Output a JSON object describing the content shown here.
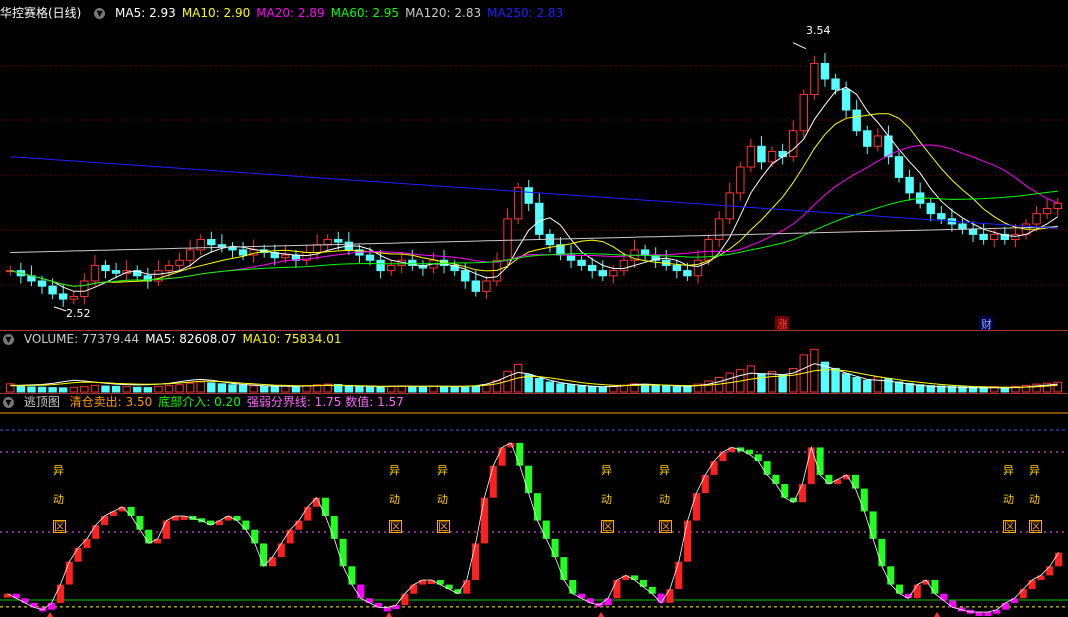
{
  "main": {
    "title": "华控赛格(日线)",
    "ma_labels": [
      {
        "text": "MA5: 2.93",
        "color": "#ffffff"
      },
      {
        "text": "MA10: 2.90",
        "color": "#ffff00"
      },
      {
        "text": "MA20: 2.89",
        "color": "#ff00ff"
      },
      {
        "text": "MA60: 2.95",
        "color": "#00ff00"
      },
      {
        "text": "MA120: 2.83",
        "color": "#cccccc"
      },
      {
        "text": "MA250: 2.83",
        "color": "#2020ff"
      }
    ],
    "high_label": "3.54",
    "low_label": "2.52",
    "tags": [
      "涨",
      "财"
    ]
  },
  "volume": {
    "labels": [
      {
        "text": "VOLUME: 77379.44",
        "color": "#cccccc"
      },
      {
        "text": "MA5: 82608.07",
        "color": "#ffffff"
      },
      {
        "text": "MA10: 75834.01",
        "color": "#ffff00"
      }
    ]
  },
  "indicator": {
    "title": "逃顶图",
    "labels": [
      {
        "text": "清仓卖出: 3.50",
        "color": "#ff9900"
      },
      {
        "text": "底部介入: 0.20",
        "color": "#00ff00"
      },
      {
        "text": "强弱分界线: 1.75 数值: 1.57",
        "color": "#ff66ff"
      }
    ],
    "signal_chars": [
      "异",
      "动",
      "区"
    ]
  },
  "chart_data": {
    "type": "candlestick",
    "price_range": [
      2.45,
      3.62
    ],
    "high": 3.54,
    "low": 2.52,
    "close_series": [
      2.66,
      2.64,
      2.62,
      2.6,
      2.57,
      2.55,
      2.56,
      2.62,
      2.68,
      2.66,
      2.65,
      2.66,
      2.64,
      2.62,
      2.66,
      2.68,
      2.7,
      2.74,
      2.78,
      2.76,
      2.75,
      2.74,
      2.72,
      2.74,
      2.73,
      2.71,
      2.72,
      2.7,
      2.73,
      2.76,
      2.78,
      2.77,
      2.74,
      2.72,
      2.7,
      2.66,
      2.68,
      2.7,
      2.68,
      2.67,
      2.7,
      2.68,
      2.66,
      2.62,
      2.58,
      2.62,
      2.7,
      2.86,
      2.98,
      2.92,
      2.8,
      2.76,
      2.72,
      2.7,
      2.68,
      2.66,
      2.64,
      2.66,
      2.7,
      2.74,
      2.72,
      2.7,
      2.68,
      2.66,
      2.64,
      2.7,
      2.78,
      2.86,
      2.96,
      3.06,
      3.14,
      3.08,
      3.12,
      3.1,
      3.2,
      3.34,
      3.46,
      3.4,
      3.36,
      3.28,
      3.2,
      3.14,
      3.18,
      3.1,
      3.02,
      2.96,
      2.92,
      2.88,
      2.86,
      2.84,
      2.82,
      2.8,
      2.78,
      2.8,
      2.78,
      2.8,
      2.84,
      2.88,
      2.9,
      2.92
    ],
    "volume_series": [
      52,
      38,
      32,
      30,
      28,
      26,
      30,
      34,
      42,
      38,
      36,
      34,
      30,
      28,
      36,
      40,
      46,
      56,
      64,
      58,
      52,
      46,
      42,
      40,
      38,
      36,
      38,
      34,
      40,
      46,
      50,
      48,
      42,
      38,
      34,
      30,
      34,
      36,
      34,
      32,
      36,
      34,
      30,
      30,
      36,
      46,
      72,
      132,
      176,
      110,
      86,
      64,
      52,
      46,
      40,
      36,
      32,
      36,
      44,
      52,
      48,
      42,
      38,
      34,
      34,
      50,
      70,
      92,
      120,
      142,
      166,
      116,
      130,
      110,
      150,
      236,
      272,
      190,
      150,
      116,
      92,
      74,
      96,
      84,
      64,
      54,
      46,
      40,
      38,
      36,
      34,
      32,
      30,
      34,
      30,
      36,
      42,
      50,
      56,
      62
    ],
    "volume_ma5": [
      84,
      86,
      90,
      96,
      110,
      130,
      150,
      140,
      126,
      112,
      100,
      94,
      90,
      92,
      100,
      110,
      130,
      150,
      160,
      150,
      130,
      110,
      96,
      88,
      80,
      76,
      74,
      72,
      76,
      82,
      86,
      84,
      80,
      76,
      72,
      68,
      72,
      76,
      74,
      72,
      74,
      72,
      70,
      72,
      80,
      100,
      140,
      200,
      250,
      230,
      190,
      150,
      120,
      100,
      84,
      74,
      68,
      70,
      80,
      96,
      100,
      94,
      86,
      78,
      74,
      82,
      100,
      130,
      170,
      210,
      240,
      230,
      230,
      220,
      240,
      300,
      360,
      330,
      290,
      240,
      200,
      160,
      150,
      140,
      120,
      100,
      84,
      72,
      66,
      62,
      58,
      54,
      52,
      54,
      52,
      56,
      64,
      76,
      88,
      100
    ],
    "volume_ma10": [
      80,
      82,
      84,
      86,
      94,
      106,
      120,
      126,
      124,
      118,
      110,
      106,
      100,
      98,
      100,
      104,
      114,
      126,
      136,
      138,
      132,
      122,
      112,
      104,
      96,
      88,
      84,
      80,
      80,
      82,
      84,
      84,
      82,
      80,
      76,
      74,
      74,
      74,
      74,
      72,
      72,
      72,
      72,
      72,
      76,
      86,
      106,
      140,
      180,
      200,
      196,
      180,
      160,
      140,
      120,
      106,
      94,
      86,
      82,
      84,
      88,
      90,
      88,
      84,
      82,
      82,
      88,
      100,
      118,
      140,
      164,
      182,
      196,
      204,
      214,
      240,
      270,
      282,
      282,
      268,
      246,
      220,
      196,
      176,
      156,
      138,
      122,
      108,
      96,
      86,
      78,
      70,
      66,
      62,
      60,
      60,
      62,
      68,
      76,
      86
    ],
    "indicator_range": [
      0,
      4.2
    ],
    "indicator_series": [
      0.4,
      0.3,
      0.2,
      0.1,
      0.05,
      0.2,
      0.6,
      1.1,
      1.4,
      1.6,
      1.9,
      2.1,
      2.2,
      2.3,
      2.1,
      1.8,
      1.5,
      1.6,
      2.0,
      2.1,
      2.1,
      2.05,
      2.0,
      1.9,
      2.0,
      2.1,
      2.0,
      1.8,
      1.5,
      1.0,
      1.2,
      1.5,
      1.8,
      2.0,
      2.3,
      2.5,
      2.1,
      1.6,
      1.0,
      0.6,
      0.3,
      0.2,
      0.1,
      0.1,
      0.15,
      0.4,
      0.6,
      0.7,
      0.7,
      0.6,
      0.5,
      0.4,
      0.7,
      1.5,
      2.5,
      3.2,
      3.6,
      3.7,
      3.2,
      2.6,
      2.0,
      1.6,
      1.2,
      0.7,
      0.4,
      0.3,
      0.2,
      0.15,
      0.3,
      0.7,
      0.8,
      0.7,
      0.55,
      0.4,
      0.2,
      0.5,
      1.1,
      2.0,
      2.6,
      3.0,
      3.3,
      3.5,
      3.6,
      3.55,
      3.45,
      3.3,
      3.0,
      2.8,
      2.5,
      2.4,
      2.8,
      3.6,
      3.0,
      2.8,
      2.9,
      3.0,
      2.7,
      2.2,
      1.6,
      1.0,
      0.6,
      0.4,
      0.3,
      0.6,
      0.7,
      0.4,
      0.25,
      0.1,
      0.05,
      0.0,
      0.0,
      0.0,
      0.05,
      0.2,
      0.3,
      0.5,
      0.7,
      0.8,
      1.0,
      1.3
    ],
    "strong_weak_line": 1.75,
    "clear_sell_line": 3.5,
    "bottom_line": 0.2
  }
}
